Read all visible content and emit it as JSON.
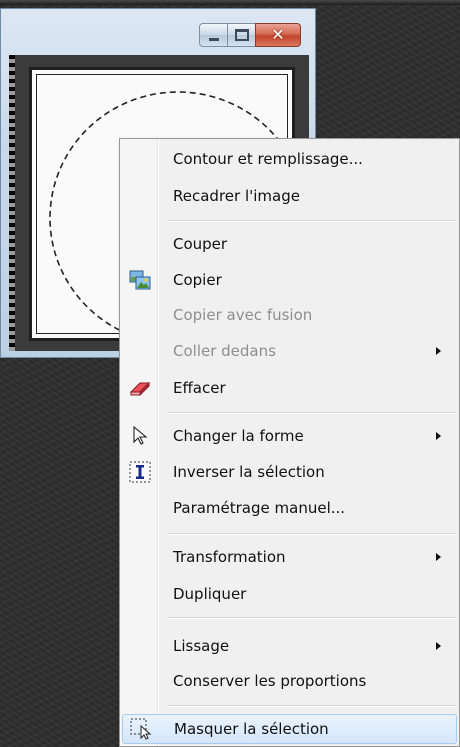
{
  "window": {
    "buttons": {
      "minimize": "minimize",
      "maximize": "maximize",
      "close": "close"
    }
  },
  "context_menu": {
    "items": [
      {
        "label": "Contour et remplissage...",
        "enabled": true
      },
      {
        "label": "Recadrer l'image",
        "enabled": true
      },
      {
        "label": "Couper",
        "enabled": true
      },
      {
        "label": "Copier",
        "enabled": true,
        "icon": "copy-pictures-icon"
      },
      {
        "label": "Copier avec fusion",
        "enabled": false
      },
      {
        "label": "Coller dedans",
        "enabled": false,
        "submenu": true
      },
      {
        "label": "Effacer",
        "enabled": true,
        "icon": "eraser-icon"
      },
      {
        "label": "Changer la forme",
        "enabled": true,
        "submenu": true,
        "icon": "pointer-arrow-icon"
      },
      {
        "label": "Inverser la sélection",
        "enabled": true,
        "icon": "invert-selection-icon"
      },
      {
        "label": "Paramétrage manuel...",
        "enabled": true
      },
      {
        "label": "Transformation",
        "enabled": true,
        "submenu": true
      },
      {
        "label": "Dupliquer",
        "enabled": true
      },
      {
        "label": "Lissage",
        "enabled": true,
        "submenu": true
      },
      {
        "label": "Conserver les proportions",
        "enabled": true
      },
      {
        "label": "Masquer la sélection",
        "enabled": true,
        "highlighted": true,
        "icon": "hide-selection-icon"
      }
    ]
  },
  "colors": {
    "menu_bg": "#f0f0f0",
    "disabled_text": "#8e8e8e",
    "highlight_border": "#a7cbf2",
    "close_button": "#c1452c"
  }
}
